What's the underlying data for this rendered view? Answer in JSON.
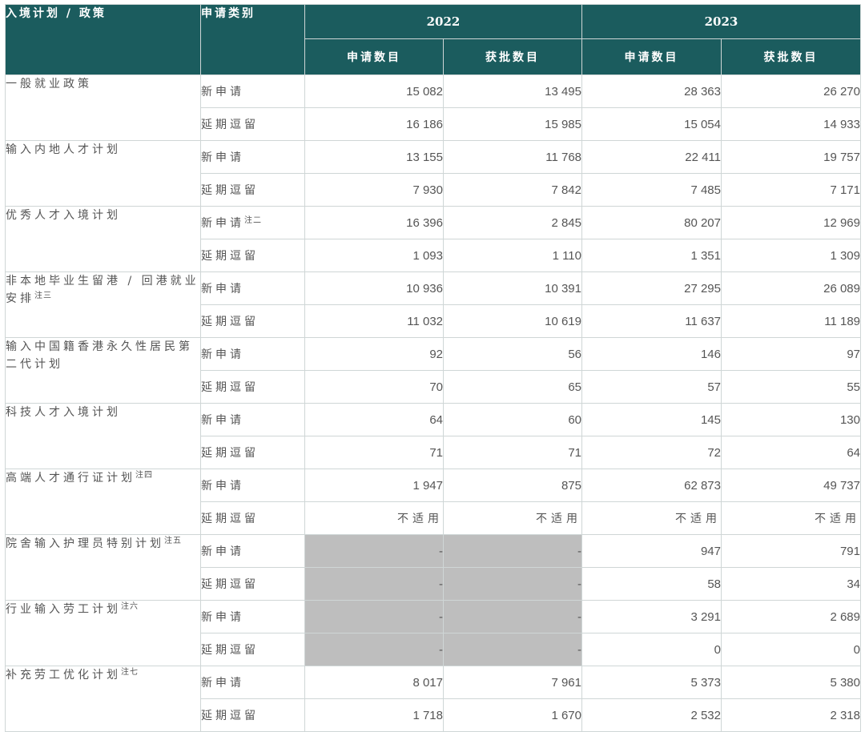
{
  "header": {
    "program": "入境计划 / 政策",
    "type": "申请类别",
    "years": [
      "2022",
      "2023"
    ],
    "applied": "申请数目",
    "approved": "获批数目"
  },
  "programs": [
    {
      "name": "一般就业政策",
      "note": "",
      "rows": [
        {
          "type": "新申请",
          "note": "",
          "values": [
            "15 082",
            "13 495",
            "28 363",
            "26 270"
          ]
        },
        {
          "type": "延期逗留",
          "note": "",
          "values": [
            "16 186",
            "15 985",
            "15 054",
            "14 933"
          ]
        }
      ]
    },
    {
      "name": "输入内地人才计划",
      "note": "",
      "rows": [
        {
          "type": "新申请",
          "note": "",
          "values": [
            "13 155",
            "11 768",
            "22 411",
            "19 757"
          ]
        },
        {
          "type": "延期逗留",
          "note": "",
          "values": [
            "7 930",
            "7 842",
            "7 485",
            "7 171"
          ]
        }
      ]
    },
    {
      "name": "优秀人才入境计划",
      "note": "",
      "rows": [
        {
          "type": "新申请",
          "note": "注二",
          "values": [
            "16 396",
            "2 845",
            "80 207",
            "12 969"
          ]
        },
        {
          "type": "延期逗留",
          "note": "",
          "values": [
            "1 093",
            "1 110",
            "1 351",
            "1 309"
          ]
        }
      ]
    },
    {
      "name": "非本地毕业生留港 / 回港就业安排",
      "note": "注三",
      "rows": [
        {
          "type": "新申请",
          "note": "",
          "values": [
            "10 936",
            "10 391",
            "27 295",
            "26 089"
          ]
        },
        {
          "type": "延期逗留",
          "note": "",
          "values": [
            "11 032",
            "10 619",
            "11 637",
            "11 189"
          ]
        }
      ]
    },
    {
      "name": "输入中国籍香港永久性居民第二代计划",
      "note": "",
      "rows": [
        {
          "type": "新申请",
          "note": "",
          "values": [
            "92",
            "56",
            "146",
            "97"
          ]
        },
        {
          "type": "延期逗留",
          "note": "",
          "values": [
            "70",
            "65",
            "57",
            "55"
          ]
        }
      ]
    },
    {
      "name": "科技人才入境计划",
      "note": "",
      "rows": [
        {
          "type": "新申请",
          "note": "",
          "values": [
            "64",
            "60",
            "145",
            "130"
          ]
        },
        {
          "type": "延期逗留",
          "note": "",
          "values": [
            "71",
            "71",
            "72",
            "64"
          ]
        }
      ]
    },
    {
      "name": "高端人才通行证计划",
      "note": "注四",
      "rows": [
        {
          "type": "新申请",
          "note": "",
          "values": [
            "1 947",
            "875",
            "62 873",
            "49 737"
          ]
        },
        {
          "type": "延期逗留",
          "note": "",
          "values": [
            "不适用",
            "不适用",
            "不适用",
            "不适用"
          ]
        }
      ]
    },
    {
      "name": "院舍输入护理员特别计划",
      "note": "注五",
      "rows": [
        {
          "type": "新申请",
          "note": "",
          "values": [
            "-",
            "-",
            "947",
            "791"
          ]
        },
        {
          "type": "延期逗留",
          "note": "",
          "values": [
            "-",
            "-",
            "58",
            "34"
          ]
        }
      ]
    },
    {
      "name": "行业输入劳工计划",
      "note": "注六",
      "rows": [
        {
          "type": "新申请",
          "note": "",
          "values": [
            "-",
            "-",
            "3 291",
            "2 689"
          ]
        },
        {
          "type": "延期逗留",
          "note": "",
          "values": [
            "-",
            "-",
            "0",
            "0"
          ]
        }
      ]
    },
    {
      "name": "补充劳工优化计划",
      "note": "注七",
      "rows": [
        {
          "type": "新申请",
          "note": "",
          "values": [
            "8 017",
            "7 961",
            "5 373",
            "5 380"
          ]
        },
        {
          "type": "延期逗留",
          "note": "",
          "values": [
            "1 718",
            "1 670",
            "2 532",
            "2 318"
          ]
        }
      ]
    }
  ]
}
